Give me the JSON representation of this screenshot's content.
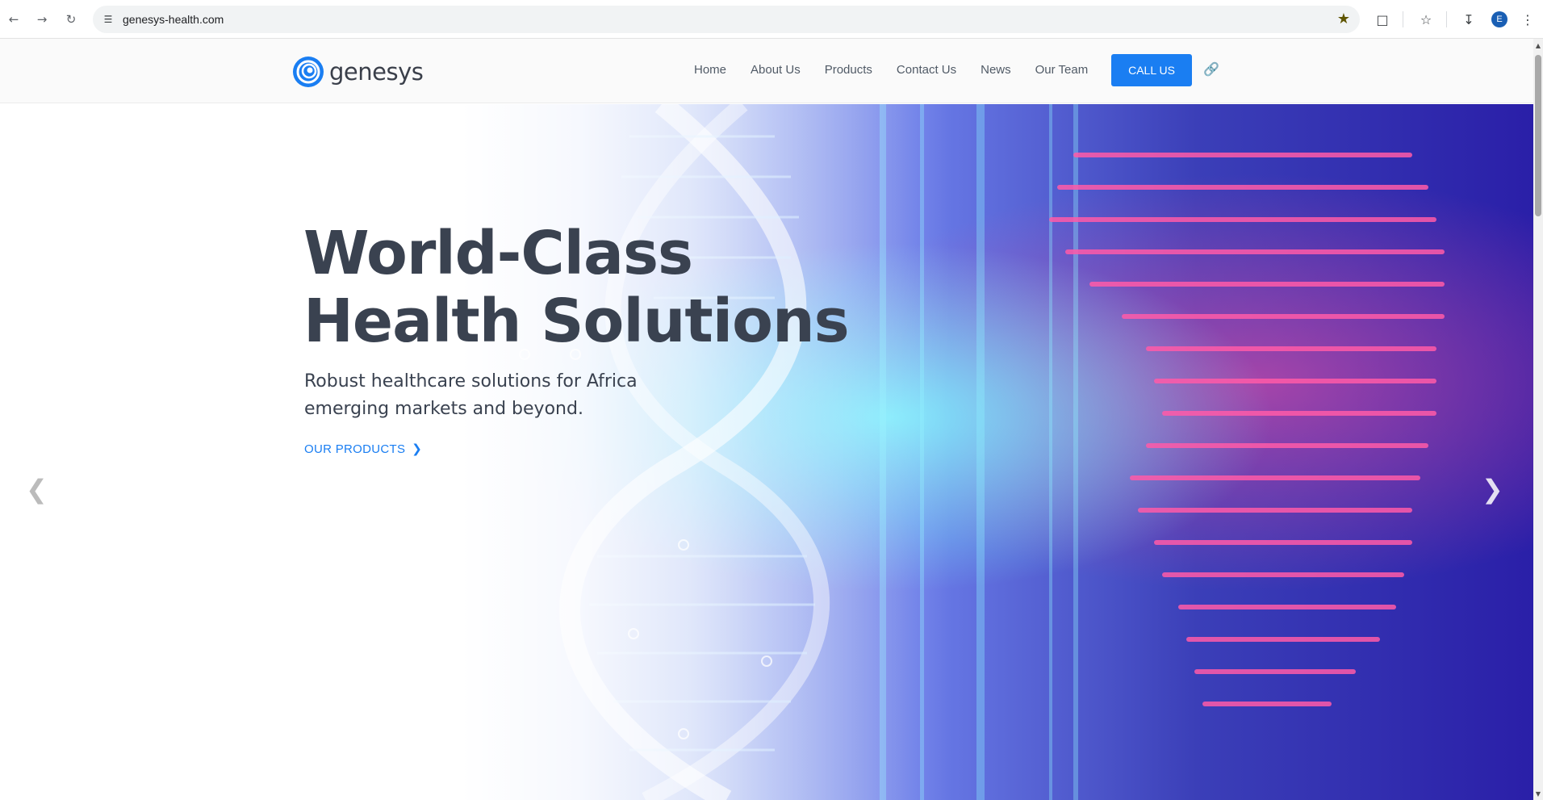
{
  "browser": {
    "url": "genesys-health.com",
    "back_icon": "arrow-left-icon",
    "forward_icon": "arrow-right-icon",
    "reload_icon": "reload-icon",
    "profile_initial": "E"
  },
  "site": {
    "logo_text": "genesys",
    "nav": [
      "Home",
      "About Us",
      "Products",
      "Contact Us",
      "News",
      "Our Team"
    ],
    "call_label": "CALL US",
    "accent": "#1a7ef2"
  },
  "hero": {
    "title_line1": "World-Class",
    "title_line2": "Health Solutions",
    "subtitle_line1": "Robust healthcare solutions for Africa",
    "subtitle_line2": "emerging markets and beyond.",
    "cta_label": "OUR PRODUCTS"
  }
}
